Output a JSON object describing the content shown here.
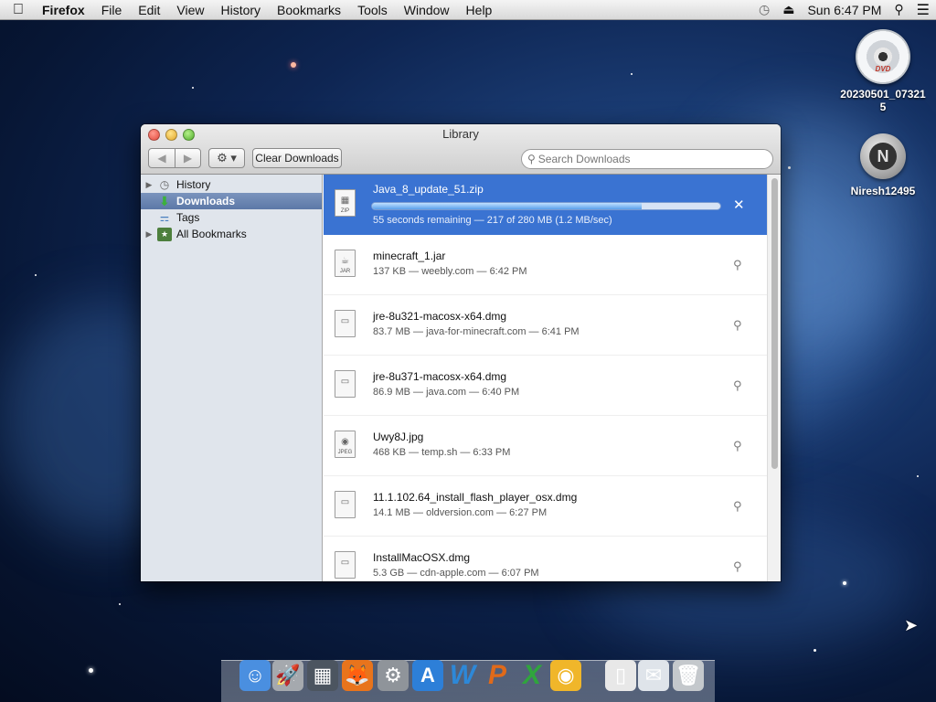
{
  "menubar": {
    "apple_icon": "apple-icon",
    "app_name": "Firefox",
    "menus": [
      "File",
      "Edit",
      "View",
      "History",
      "Bookmarks",
      "Tools",
      "Window",
      "Help"
    ],
    "clock": "Sun 6:47 PM",
    "status_icons": [
      "time-machine-icon",
      "eject-icon",
      "spotlight-search-icon",
      "notification-list-icon"
    ]
  },
  "desktop": {
    "icons": [
      {
        "label": "20230501_073215",
        "icon": "dvd-icon",
        "disc_text": "DVD"
      },
      {
        "label": "Niresh12495",
        "icon": "server-disk-icon",
        "disc_text": "N"
      }
    ]
  },
  "library": {
    "title": "Library",
    "toolbar": {
      "back_icon": "◀",
      "forward_icon": "▶",
      "gear_icon": "⚙ ▾",
      "clear_label": "Clear Downloads",
      "search_placeholder": "Search Downloads"
    },
    "sidebar": {
      "items": [
        {
          "label": "History",
          "icon": "clock-icon",
          "expandable": true,
          "selected": false
        },
        {
          "label": "Downloads",
          "icon": "download-arrow-icon",
          "expandable": false,
          "selected": true
        },
        {
          "label": "Tags",
          "icon": "tag-icon",
          "expandable": false,
          "selected": false
        },
        {
          "label": "All Bookmarks",
          "icon": "bookmarks-icon",
          "expandable": true,
          "selected": false
        }
      ]
    },
    "downloads": [
      {
        "name": "Java_8_update_51.zip",
        "status": "55 seconds remaining — 217 of 280 MB (1.2 MB/sec)",
        "type": "ZIP",
        "active": true,
        "progress": 0.775
      },
      {
        "name": "minecraft_1.jar",
        "status": "137 KB — weebly.com — 6:42 PM",
        "type": "JAR",
        "active": false
      },
      {
        "name": "jre-8u321-macosx-x64.dmg",
        "status": "83.7 MB — java-for-minecraft.com — 6:41 PM",
        "type": "",
        "active": false
      },
      {
        "name": "jre-8u371-macosx-x64.dmg",
        "status": "86.9 MB — java.com — 6:40 PM",
        "type": "",
        "active": false
      },
      {
        "name": "Uwy8J.jpg",
        "status": "468 KB — temp.sh — 6:33 PM",
        "type": "JPEG",
        "active": false
      },
      {
        "name": "11.1.102.64_install_flash_player_osx.dmg",
        "status": "14.1 MB — oldversion.com — 6:27 PM",
        "type": "",
        "active": false
      },
      {
        "name": "InstallMacOSX.dmg",
        "status": "5.3 GB — cdn-apple.com — 6:07 PM",
        "type": "",
        "active": false
      }
    ],
    "cancel_icon": "✕",
    "reveal_icon": "🔍"
  },
  "dock": {
    "items": [
      {
        "icon": "finder-icon",
        "glyph": "☺",
        "color": "#4a8fe0"
      },
      {
        "icon": "launchpad-icon",
        "glyph": "🚀",
        "color": "#a5a9ae"
      },
      {
        "icon": "photo-browser-icon",
        "glyph": "▦",
        "color": "#4c5560"
      },
      {
        "icon": "firefox-icon",
        "glyph": "🦊",
        "color": "#e8741c"
      },
      {
        "icon": "system-preferences-icon",
        "glyph": "⚙",
        "color": "#8f949a"
      },
      {
        "icon": "app-store-icon",
        "glyph": "A",
        "color": "#2d7fd8"
      },
      {
        "icon": "word-icon",
        "glyph": "W",
        "color": "#2d88d8"
      },
      {
        "icon": "powerpoint-icon",
        "glyph": "P",
        "color": "#e06a1a"
      },
      {
        "icon": "excel-icon",
        "glyph": "X",
        "color": "#2fa53d"
      },
      {
        "icon": "network-utility-icon",
        "glyph": "◉",
        "color": "#f0b62a"
      },
      {
        "icon": "zip-document-icon",
        "glyph": "▯",
        "color": "#e8e8e8"
      },
      {
        "icon": "mail-icon",
        "glyph": "✉",
        "color": "#dfe4ea"
      },
      {
        "icon": "trash-icon",
        "glyph": "🗑",
        "color": "#c4c8cc"
      }
    ]
  },
  "cursor_icon": "arrow-cursor-icon"
}
